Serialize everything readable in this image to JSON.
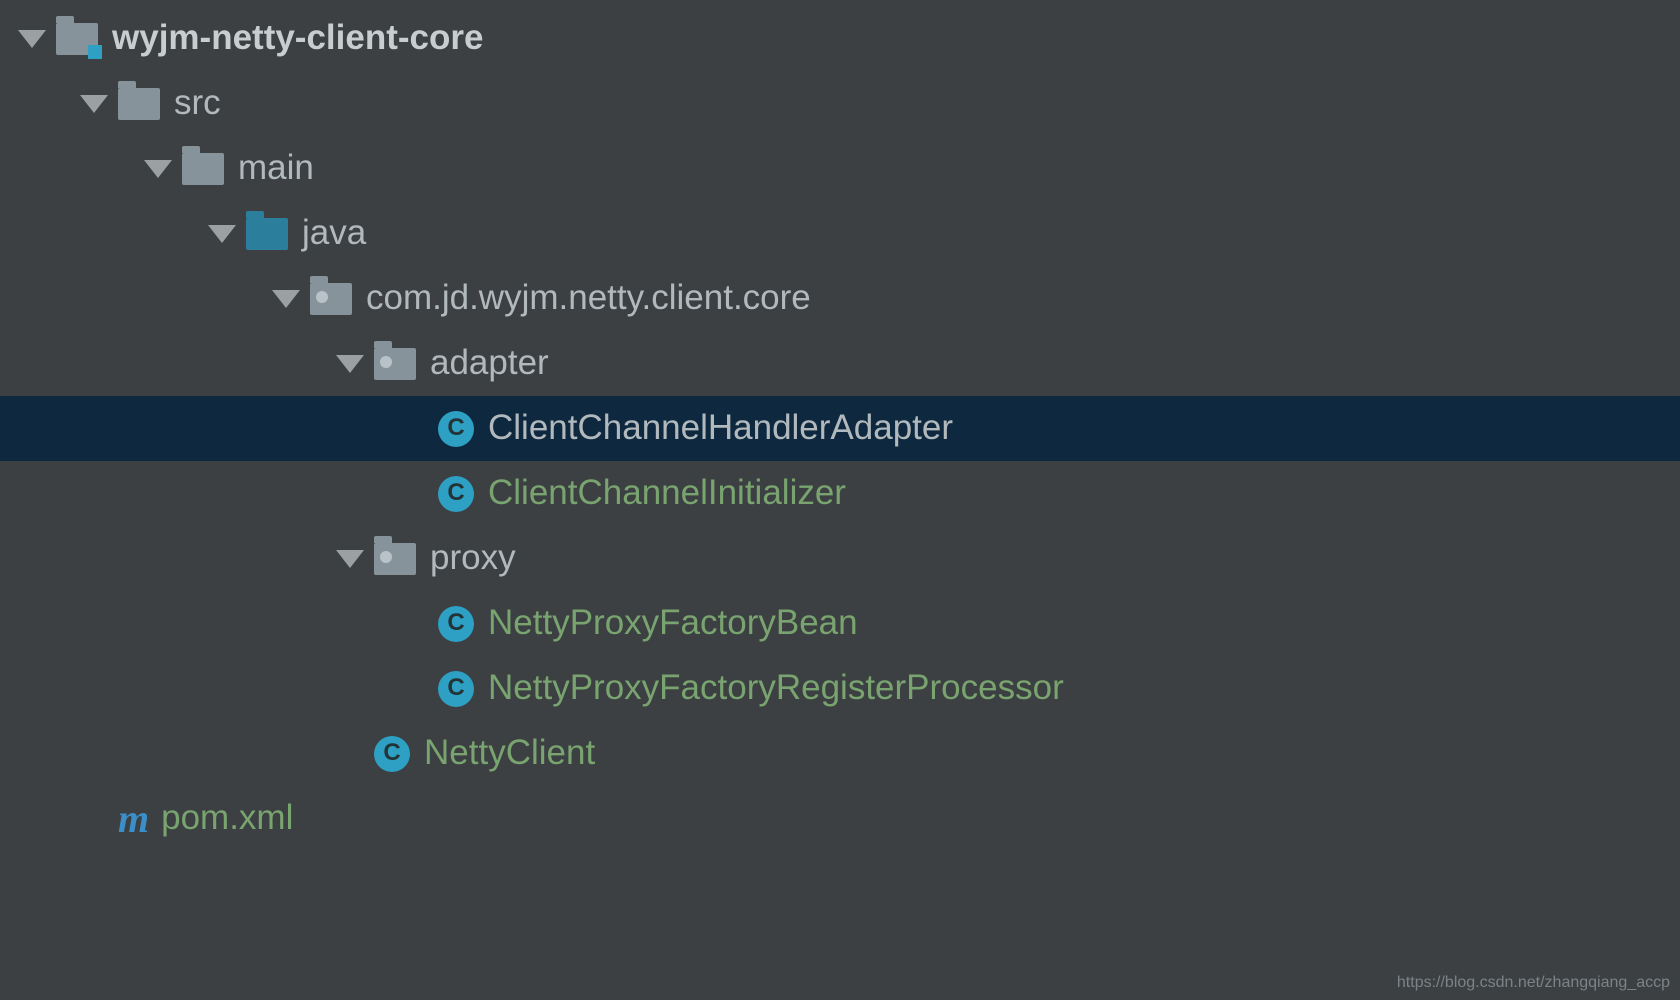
{
  "tree": {
    "root": {
      "label": "wyjm-netty-client-core"
    },
    "src": {
      "label": "src"
    },
    "main": {
      "label": "main"
    },
    "java": {
      "label": "java"
    },
    "pkg": {
      "label": "com.jd.wyjm.netty.client.core"
    },
    "adapter": {
      "label": "adapter"
    },
    "classAdapter": {
      "label": "ClientChannelHandlerAdapter"
    },
    "classInitializer": {
      "label": "ClientChannelInitializer"
    },
    "proxy": {
      "label": "proxy"
    },
    "classProxyFactoryBean": {
      "label": "NettyProxyFactoryBean"
    },
    "classProxyRegister": {
      "label": "NettyProxyFactoryRegisterProcessor"
    },
    "classNettyClient": {
      "label": "NettyClient"
    },
    "pom": {
      "label": "pom.xml"
    }
  },
  "icons": {
    "classLetter": "C",
    "mavenLetter": "m"
  },
  "watermark": "https://blog.csdn.net/zhangqiang_accp"
}
